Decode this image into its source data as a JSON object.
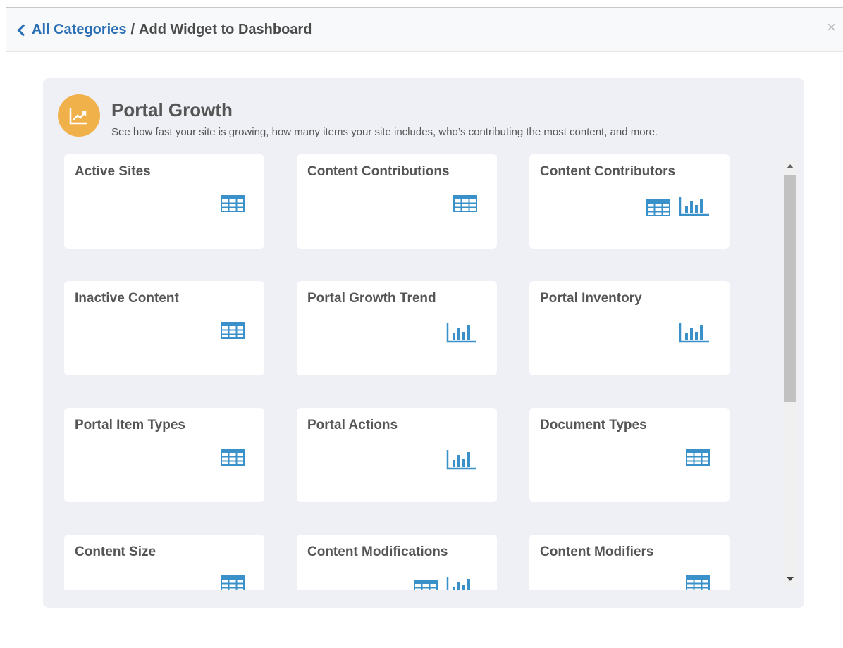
{
  "header": {
    "back_label": "All Categories",
    "separator": "/",
    "current": "Add Widget to Dashboard",
    "close_glyph": "×"
  },
  "category": {
    "title": "Portal Growth",
    "description": "See how fast your site is growing, how many items your site includes, who’s contributing the most content, and more.",
    "icon": "trend-chart-icon",
    "icon_color": "#f0b14a"
  },
  "colors": {
    "accent": "#2a6eb5",
    "icon_blue": "#3a90c8"
  },
  "widgets": [
    {
      "title": "Active Sites",
      "icons": [
        "table"
      ]
    },
    {
      "title": "Content Contributions",
      "icons": [
        "table"
      ]
    },
    {
      "title": "Content Contributors",
      "icons": [
        "table",
        "bar"
      ]
    },
    {
      "title": "Inactive Content",
      "icons": [
        "table"
      ]
    },
    {
      "title": "Portal Growth Trend",
      "icons": [
        "bar"
      ]
    },
    {
      "title": "Portal Inventory",
      "icons": [
        "bar"
      ]
    },
    {
      "title": "Portal Item Types",
      "icons": [
        "table"
      ]
    },
    {
      "title": "Portal Actions",
      "icons": [
        "bar"
      ]
    },
    {
      "title": "Document Types",
      "icons": [
        "table"
      ]
    },
    {
      "title": "Content Size",
      "icons": [
        "table"
      ]
    },
    {
      "title": "Content Modifications",
      "icons": [
        "table",
        "bar"
      ]
    },
    {
      "title": "Content Modifiers",
      "icons": [
        "table"
      ]
    }
  ]
}
